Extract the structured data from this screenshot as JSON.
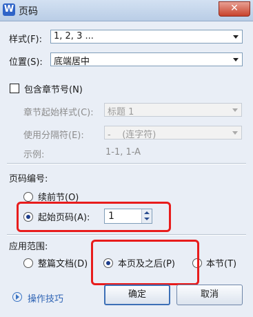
{
  "window": {
    "app_icon": "W",
    "title": "页码",
    "close_glyph": "✕"
  },
  "style_row": {
    "label": "样式(F):",
    "value": "1, 2, 3 ..."
  },
  "position_row": {
    "label": "位置(S):",
    "value": "底端居中"
  },
  "chapter": {
    "checkbox_label": "包含章节号(N)",
    "checked": false,
    "start_style_label": "章节起始样式(C):",
    "start_style_value": "标题 1",
    "separator_label": "使用分隔符(E):",
    "separator_value": "-    (连字符)",
    "example_label": "示例:",
    "example_value": "1-1, 1-A"
  },
  "numbering": {
    "heading": "页码编号:",
    "continue_label": "续前节(O)",
    "start_label": "起始页码(A):",
    "start_value": "1",
    "selected": "start"
  },
  "scope": {
    "heading": "应用范围:",
    "whole_doc_label": "整篇文档(D)",
    "this_and_after_label": "本页及之后(P)",
    "this_section_label": "本节(T)",
    "selected": "this_and_after"
  },
  "footer": {
    "tips_label": "操作技巧",
    "ok_label": "确定",
    "cancel_label": "取消"
  },
  "colors": {
    "highlight": "#e81c1c",
    "link": "#2e63b4",
    "dialog_bg": "#e9eef6"
  }
}
